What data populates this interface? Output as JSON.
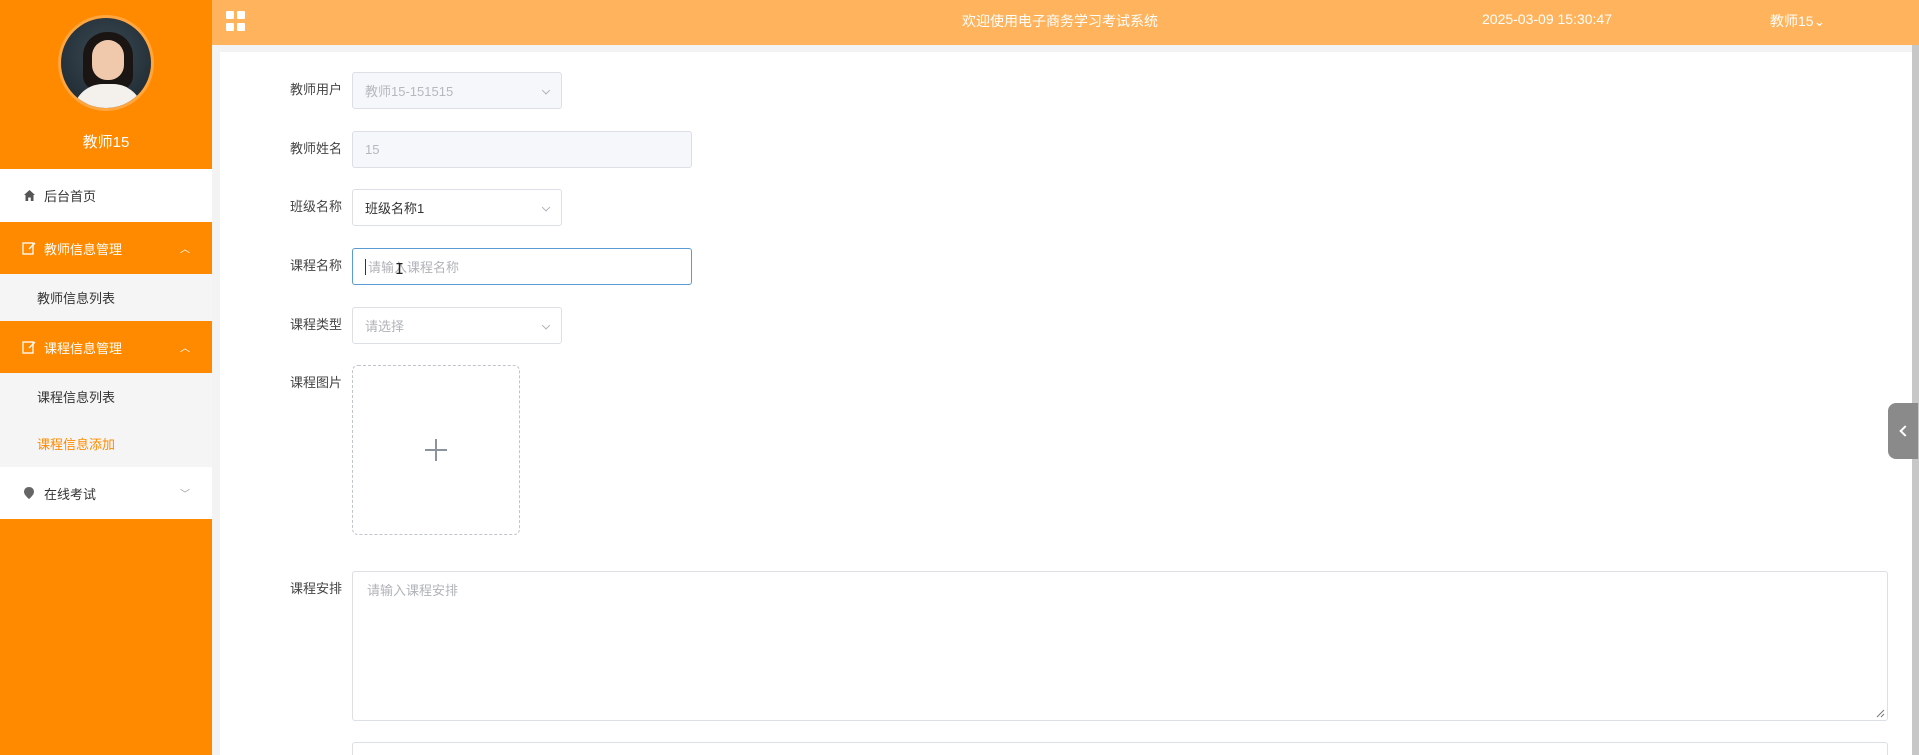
{
  "header": {
    "title": "欢迎使用电子商务学习考试系统",
    "datetime": "2025-03-09 15:30:47",
    "user_menu": "教师15⌄"
  },
  "profile": {
    "name": "教师15"
  },
  "sidebar": {
    "home": {
      "label": "后台首页",
      "icon": "home-icon"
    },
    "groups": [
      {
        "label": "教师信息管理",
        "icon": "edit-icon",
        "expanded": true,
        "items": [
          "教师信息列表"
        ]
      },
      {
        "label": "课程信息管理",
        "icon": "edit-icon",
        "expanded": true,
        "items": [
          "课程信息列表",
          "课程信息添加"
        ],
        "active_item": "课程信息添加"
      },
      {
        "label": "在线考试",
        "icon": "location-icon",
        "expanded": false
      }
    ]
  },
  "form": {
    "teacher_user": {
      "label": "教师用户",
      "value": "教师15-151515"
    },
    "teacher_name": {
      "label": "教师姓名",
      "value": "15"
    },
    "class_name": {
      "label": "班级名称",
      "value": "班级名称1"
    },
    "course_name": {
      "label": "课程名称",
      "placeholder": "请输入课程名称"
    },
    "course_type": {
      "label": "课程类型",
      "placeholder": "请选择"
    },
    "course_image": {
      "label": "课程图片"
    },
    "course_schedule": {
      "label": "课程安排",
      "placeholder": "请输入课程安排"
    }
  },
  "colors": {
    "sidebar": "#ff8a00",
    "header": "#ffb35c",
    "active_text": "#ff8a00"
  }
}
